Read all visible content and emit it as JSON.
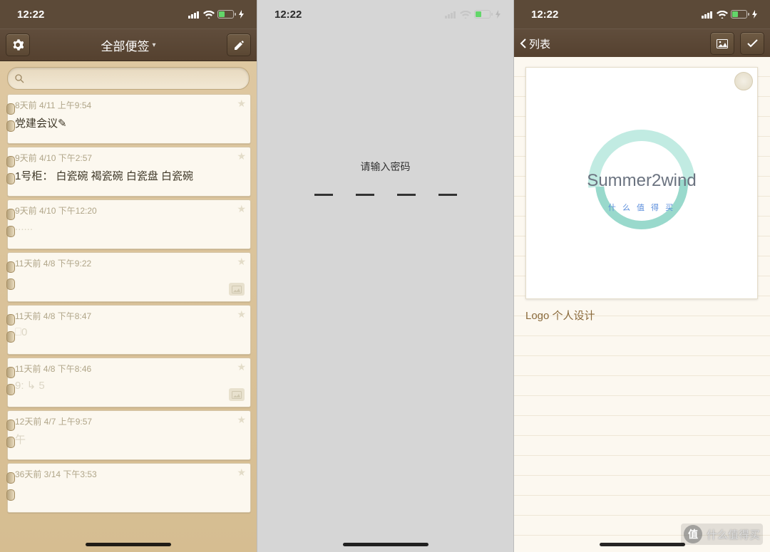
{
  "status": {
    "time": "12:22"
  },
  "p1": {
    "title": "全部便签",
    "notes": [
      {
        "meta": "8天前 4/11  上午9:54",
        "text": "党建会议✎",
        "img": false
      },
      {
        "meta": "9天前 4/10  下午2:57",
        "text": "1号柜： 白瓷碗 褐瓷碗 白瓷盘 白瓷碗",
        "img": false
      },
      {
        "meta": "9天前 4/10  下午12:20",
        "text": "......",
        "img": false,
        "faded": true
      },
      {
        "meta": "11天前 4/8  下午9:22",
        "text": " ",
        "img": true,
        "faded": true
      },
      {
        "meta": "11天前 4/8  下午8:47",
        "text": "⎕0",
        "img": false,
        "faded": true
      },
      {
        "meta": "11天前 4/8  下午8:46",
        "text": "9: ↳ 5",
        "img": true,
        "faded": true
      },
      {
        "meta": "12天前 4/7  上午9:57",
        "text": "午",
        "img": false,
        "faded": true
      },
      {
        "meta": "36天前 3/14  下午3:53",
        "text": " ",
        "img": false,
        "faded": true
      }
    ]
  },
  "p2": {
    "prompt": "请输入密码"
  },
  "p3": {
    "back": "列表",
    "logo_text": "Summer2wind",
    "logo_sub": "什 么 值 得 买",
    "caption": "Logo 个人设计"
  },
  "watermark": "什么值得买"
}
